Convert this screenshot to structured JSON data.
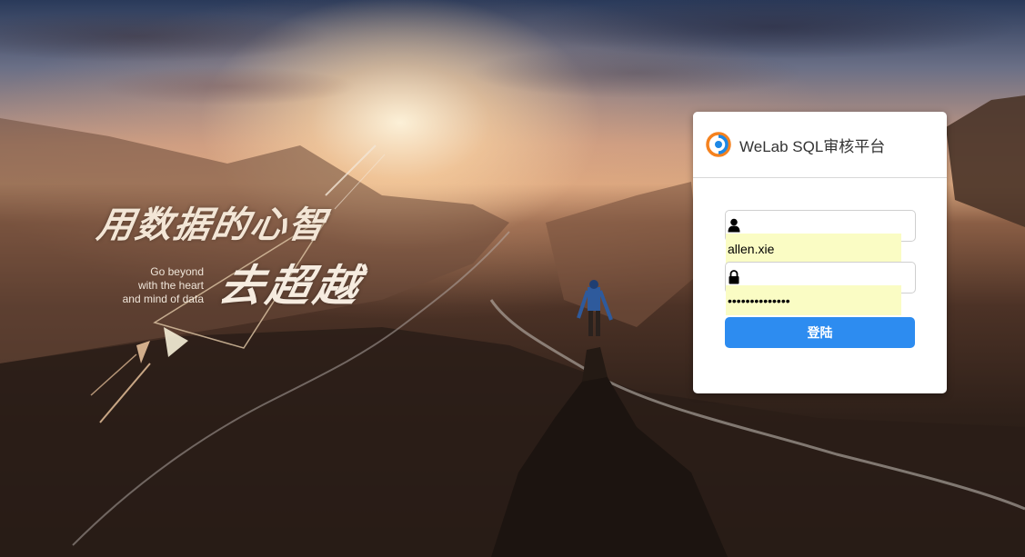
{
  "tagline": {
    "chinese_line1": "用数据的心智",
    "chinese_line2": "去超越",
    "english_lines": [
      "Go beyond",
      "with the heart",
      "and mind of data"
    ]
  },
  "login": {
    "title": "WeLab SQL审核平台",
    "username_icon": "user-icon",
    "username_value": "allen.xie",
    "password_icon": "lock-icon",
    "password_value": "••••••••••••••",
    "submit_label": "登陆"
  },
  "colors": {
    "button": "#2d8cf0",
    "autofill": "#fafcc4",
    "logo_orange": "#f5821f",
    "logo_blue": "#1e88e5"
  }
}
